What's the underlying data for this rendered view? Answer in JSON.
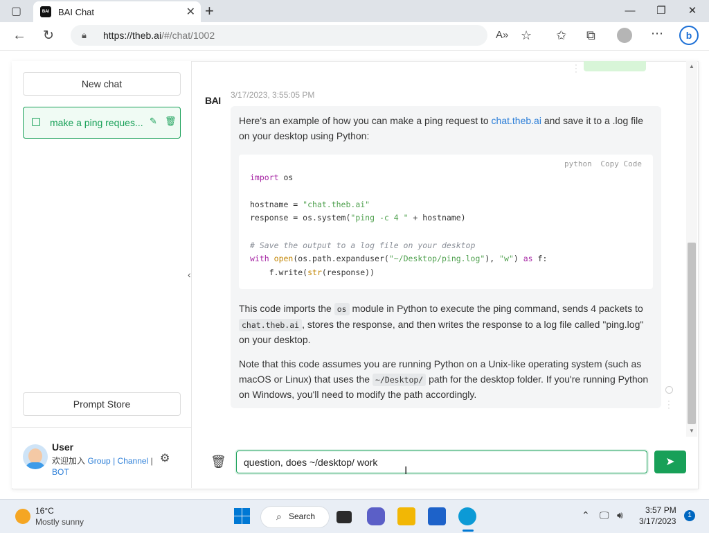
{
  "browser": {
    "tab_title": "BAI Chat",
    "favicon_text": "BAI",
    "url_host": "https://theb.ai",
    "url_path": "/#/chat/1002"
  },
  "sidebar": {
    "new_chat_label": "New chat",
    "chat_item_label": "make a ping reques...",
    "prompt_store_label": "Prompt Store",
    "user": {
      "name": "User",
      "join_text": "欢迎加入",
      "group_link": "Group",
      "channel_link": "Channel",
      "bot_link": "BOT"
    }
  },
  "message": {
    "logo": "BAI",
    "timestamp": "3/17/2023, 3:55:05 PM",
    "intro_before": "Here's an example of how you can make a ping request to ",
    "intro_link": "chat.theb.ai",
    "intro_after": " and save it to a .log file on your desktop using Python:",
    "code_lang": "python",
    "code_copy": "Copy Code",
    "para2_a": "This code imports the ",
    "para2_code1": "os",
    "para2_b": " module in Python to execute the ping command, sends 4 packets to ",
    "para2_code2": "chat.theb.ai",
    "para2_c": ", stores the response, and then writes the response to a log file called \"ping.log\" on your desktop.",
    "para3_a": "Note that this code assumes you are running Python on a Unix-like operating system (such as macOS or Linux) that uses the ",
    "para3_code": "~/Desktop/",
    "para3_b": " path for the desktop folder. If you're running Python on Windows, you'll need to modify the path accordingly."
  },
  "input": {
    "value": "question, does ~/desktop/ work "
  },
  "taskbar": {
    "weather_temp": "16°C",
    "weather_desc": "Mostly sunny",
    "search_label": "Search",
    "time": "3:57 PM",
    "date": "3/17/2023",
    "notification_count": "1"
  },
  "colors": {
    "accent_green": "#18a058",
    "link_blue": "#2d7fd8"
  }
}
